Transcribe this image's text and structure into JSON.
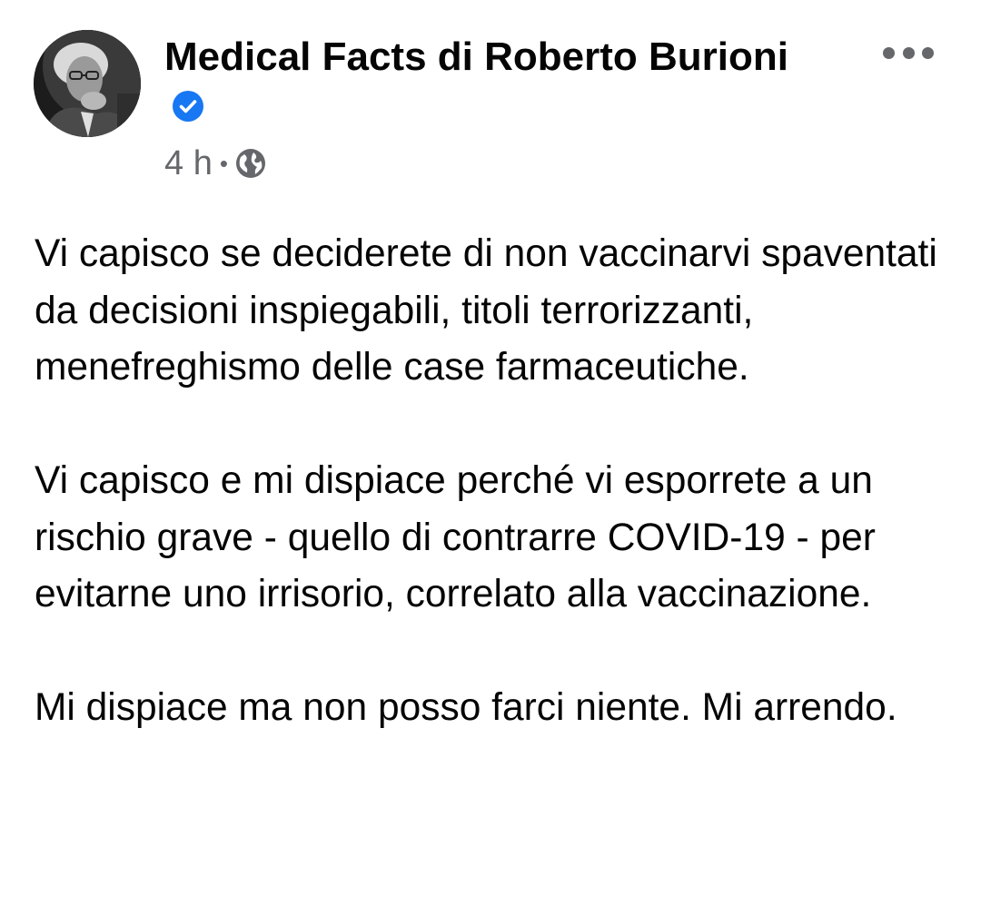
{
  "post": {
    "author": {
      "name": "Medical Facts di Roberto Burioni",
      "verified_icon": "verified-badge-icon",
      "avatar_icon": "profile-avatar-icon"
    },
    "meta": {
      "time": "4 h",
      "separator": "•",
      "audience_icon": "globe-icon"
    },
    "more_icon": "more-options-icon",
    "paragraphs": [
      "Vi capisco se deciderete di non vaccinarvi spaventati da decisioni inspiegabili, titoli terrorizzanti, menefreghismo delle case farmaceutiche.",
      "Vi capisco e mi dispiace perché vi esporrete a un rischio grave - quello di contrarre COVID-19 - per evitarne uno irrisorio, correlato alla vaccinazione.",
      "Mi dispiace ma non posso farci niente. Mi arrendo."
    ]
  },
  "colors": {
    "text": "#050505",
    "secondary": "#65676b",
    "verified_blue": "#1877f2",
    "background": "#ffffff"
  }
}
